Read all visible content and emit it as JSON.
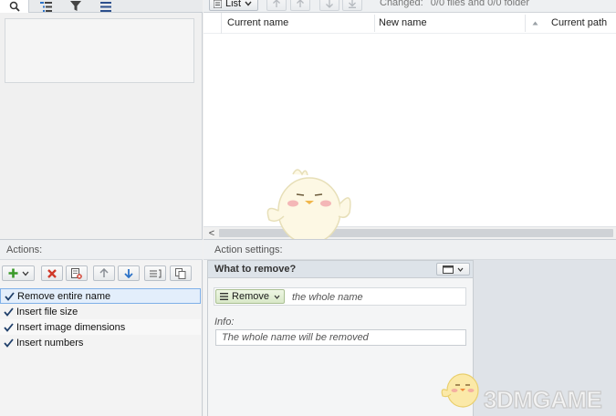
{
  "left_tabs": [
    {
      "icon": "search-icon"
    },
    {
      "icon": "tree-list-icon"
    },
    {
      "icon": "filter-icon"
    },
    {
      "icon": "menu-icon"
    }
  ],
  "toolbar": {
    "view_label": "List",
    "status_label": "Changed:",
    "status_value": "0/0 files and 0/0 folder"
  },
  "columns": [
    "Current name",
    "New name",
    "Current path"
  ],
  "actions": {
    "header": "Actions:",
    "items": [
      {
        "label": "Remove entire name",
        "checked": true,
        "selected": true
      },
      {
        "label": "Insert file size",
        "checked": true,
        "selected": false
      },
      {
        "label": "Insert image dimensions",
        "checked": true,
        "selected": false
      },
      {
        "label": "Insert numbers",
        "checked": true,
        "selected": false
      }
    ]
  },
  "settings": {
    "header": "Action settings:",
    "group_title": "What to remove?",
    "remove_label": "Remove",
    "remove_desc": "the whole name",
    "info_label": "Info:",
    "info_text": "The whole name will be removed"
  },
  "scroll": {
    "left_arrow": "<"
  },
  "watermark": "3DMGAME",
  "colors": {
    "accent": "#2f7bd4",
    "add_green": "#3a9a2a",
    "delete_red": "#d03a2a",
    "arrow_blue": "#2c72c7",
    "selection_bg": "#e3eefb",
    "panel_header": "#dde3e9"
  }
}
